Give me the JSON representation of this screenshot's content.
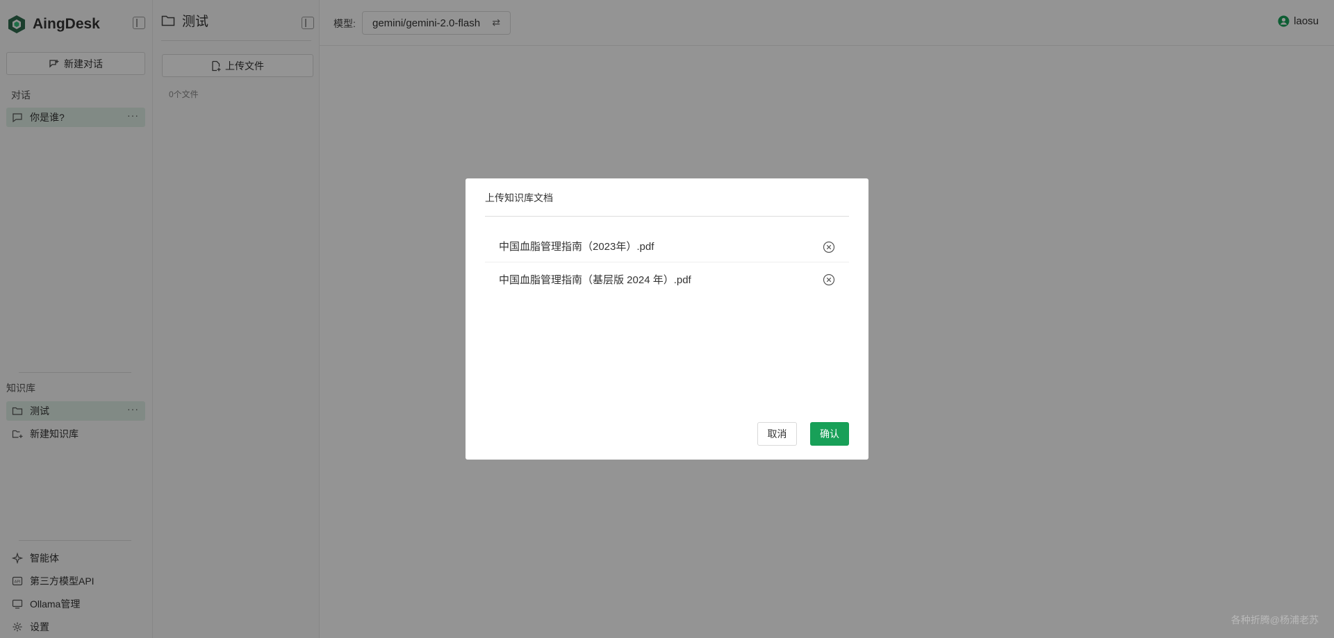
{
  "app": {
    "name": "AingDesk"
  },
  "sidebar": {
    "new_chat_label": "新建对话",
    "conversations_label": "对话",
    "conversations": [
      {
        "label": "你是谁?",
        "more": "···"
      }
    ],
    "knowledge_label": "知识库",
    "knowledge_bases": [
      {
        "label": "测试",
        "more": "···"
      }
    ],
    "new_kb_label": "新建知识库",
    "bottom_items": [
      {
        "label": "智能体",
        "icon": "sparkle-icon"
      },
      {
        "label": "第三方模型API",
        "icon": "api-icon"
      },
      {
        "label": "Ollama管理",
        "icon": "monitor-icon"
      },
      {
        "label": "设置",
        "icon": "gear-icon"
      }
    ]
  },
  "panel": {
    "title": "测试",
    "upload_label": "上传文件",
    "file_count": "0个文件"
  },
  "header": {
    "model_label": "模型:",
    "model_value": "gemini/gemini-2.0-flash",
    "user": "laosu"
  },
  "modal": {
    "title": "上传知识库文档",
    "files": [
      "中国血脂管理指南（2023年）.pdf",
      "中国血脂管理指南（基层版 2024 年）.pdf"
    ],
    "cancel_label": "取消",
    "confirm_label": "确认"
  },
  "watermark": "各种折腾@杨浦老苏",
  "colors": {
    "accent": "#18a058",
    "active_bg": "#dfeee5",
    "logo": "#2f6b4f"
  }
}
